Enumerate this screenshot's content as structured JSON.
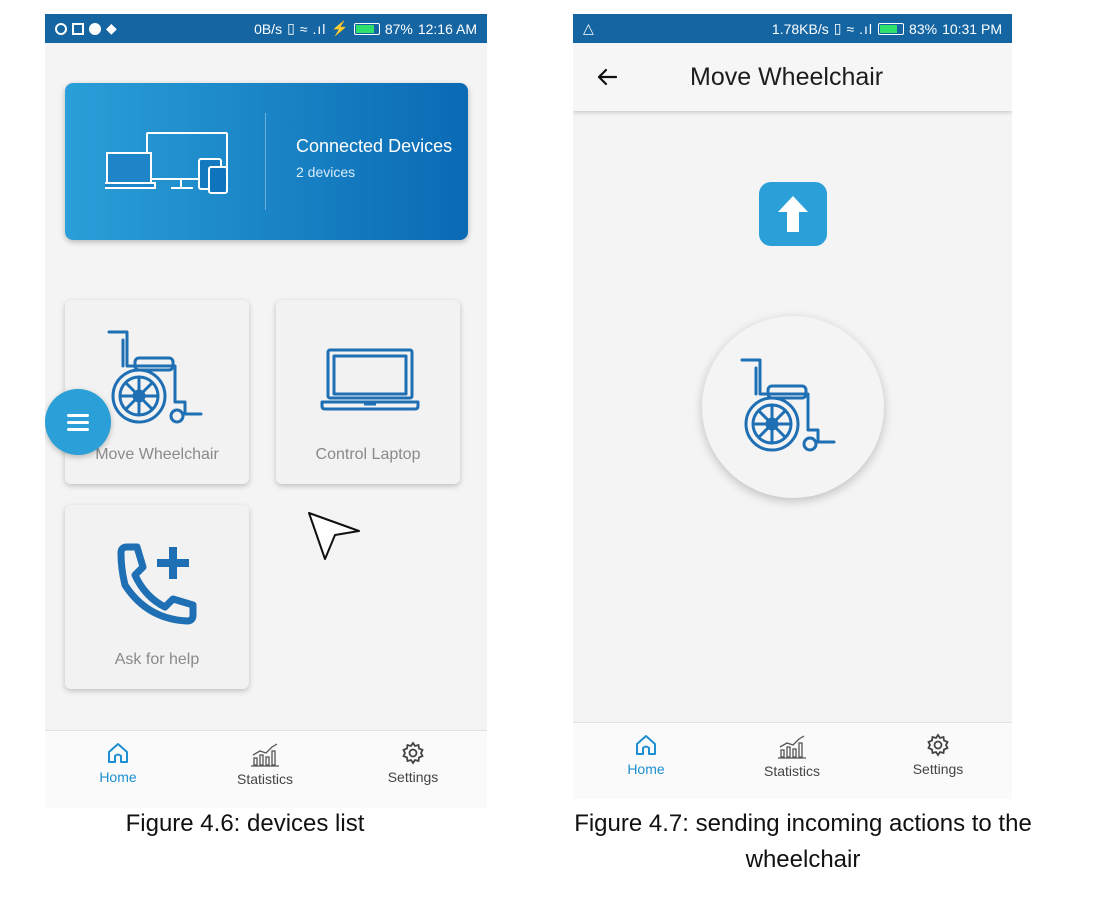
{
  "phone1": {
    "status_bar": {
      "speed": "0B/s",
      "battery": "87%",
      "battery_level": 0.87,
      "time": "12:16 AM"
    },
    "connected_card": {
      "title": "Connected Devices",
      "subtitle": "2 devices",
      "icon": "devices-icon"
    },
    "tiles": [
      {
        "label": "Move Wheelchair",
        "icon": "wheelchair-icon"
      },
      {
        "label": "Control Laptop",
        "icon": "laptop-icon"
      },
      {
        "label": "Ask for help",
        "icon": "phone-add-icon"
      }
    ],
    "fab_icon": "menu-icon",
    "bottom_nav": [
      {
        "label": "Home",
        "icon": "home-icon",
        "active": true
      },
      {
        "label": "Statistics",
        "icon": "statistics-icon",
        "active": false
      },
      {
        "label": "Settings",
        "icon": "settings-icon",
        "active": false
      }
    ]
  },
  "phone2": {
    "status_bar": {
      "speed": "1.78KB/s",
      "battery": "83%",
      "battery_level": 0.83,
      "time": "10:31 PM"
    },
    "appbar": {
      "title": "Move Wheelchair",
      "back_icon": "arrow-left-icon"
    },
    "up_button_icon": "arrow-up-icon",
    "wheelchair_icon": "wheelchair-icon",
    "bottom_nav": [
      {
        "label": "Home",
        "icon": "home-icon",
        "active": true
      },
      {
        "label": "Statistics",
        "icon": "statistics-icon",
        "active": false
      },
      {
        "label": "Settings",
        "icon": "settings-icon",
        "active": false
      }
    ]
  },
  "captions": {
    "figure_4_6": "Figure 4.6: devices list",
    "figure_4_7": "Figure 4.7: sending incoming actions to the wheelchair"
  },
  "colors": {
    "accent": "#2a9fd8",
    "status_bar": "#1565a3",
    "icon_blue": "#1e6fb3",
    "nav_active": "#1e8fd0"
  }
}
